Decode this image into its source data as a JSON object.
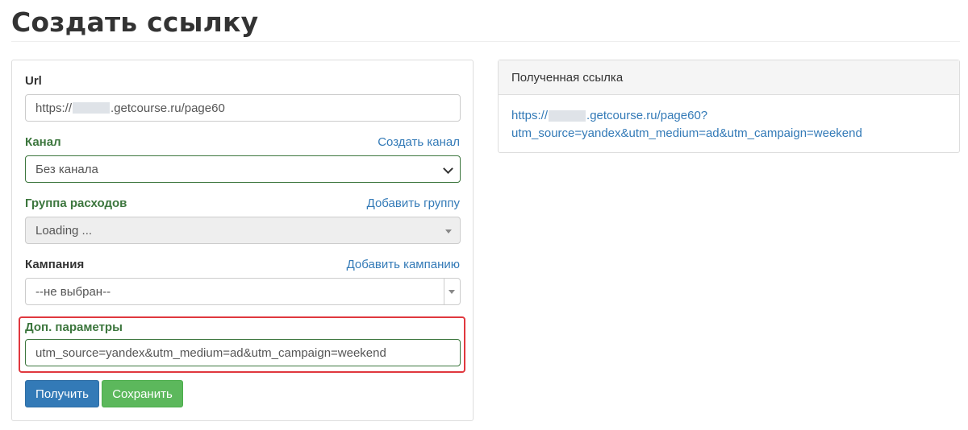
{
  "page": {
    "title": "Создать ссылку"
  },
  "form": {
    "url": {
      "label": "Url",
      "value_prefix": "https://",
      "value_suffix": ".getcourse.ru/page60"
    },
    "channel": {
      "label": "Канал",
      "action_link": "Создать канал",
      "selected": "Без канала"
    },
    "expense_group": {
      "label": "Группа расходов",
      "action_link": "Добавить группу",
      "selected": "Loading ..."
    },
    "campaign": {
      "label": "Кампания",
      "action_link": "Добавить кампанию",
      "selected": "--не выбран--"
    },
    "extra_params": {
      "label": "Доп. параметры",
      "value": "utm_source=yandex&utm_medium=ad&utm_campaign=weekend"
    },
    "buttons": {
      "get": "Получить",
      "save": "Сохранить"
    }
  },
  "result": {
    "heading": "Полученная ссылка",
    "link_prefix": "https://",
    "link_line1_suffix": ".getcourse.ru/page60?",
    "link_line2": "utm_source=yandex&utm_medium=ad&utm_campaign=weekend"
  },
  "colors": {
    "primary": "#337ab7",
    "success": "#5cb85c",
    "success_text": "#3c763d",
    "highlight": "#e0383e"
  }
}
